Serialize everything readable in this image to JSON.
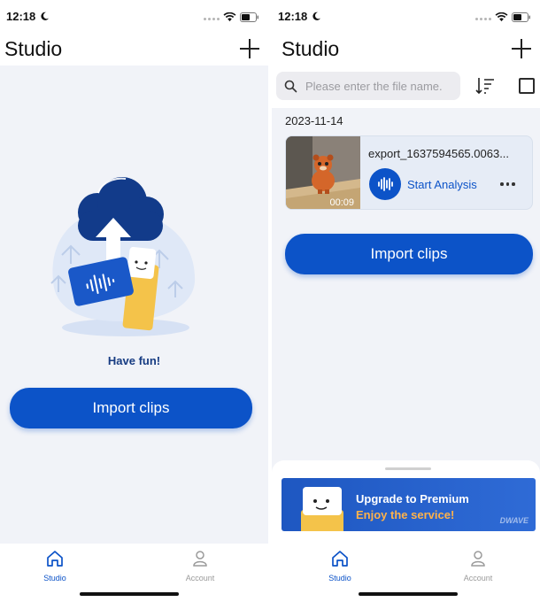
{
  "status_bar": {
    "time": "12:18"
  },
  "header": {
    "title": "Studio"
  },
  "empty_state": {
    "message": "Have fun!"
  },
  "actions": {
    "import_label": "Import clips"
  },
  "search": {
    "placeholder": "Please enter the file name."
  },
  "clips": {
    "date": "2023-11-14",
    "items": [
      {
        "name": "export_1637594565.0063...",
        "duration": "00:09",
        "action_label": "Start Analysis"
      }
    ]
  },
  "promo": {
    "title": "Upgrade to Premium",
    "subtitle": "Enjoy the service!",
    "brand": "DWAVE"
  },
  "tabbar": {
    "studio": "Studio",
    "account": "Account"
  },
  "colors": {
    "primary": "#0c53c8",
    "promo_accent": "#ffb24a",
    "dark_navy": "#163b82"
  },
  "icons": [
    "moon-icon",
    "wifi-icon",
    "battery-icon",
    "plus-icon",
    "search-icon",
    "sort-icon",
    "checkbox-icon",
    "waveform-icon",
    "more-icon",
    "home-icon",
    "person-icon"
  ]
}
